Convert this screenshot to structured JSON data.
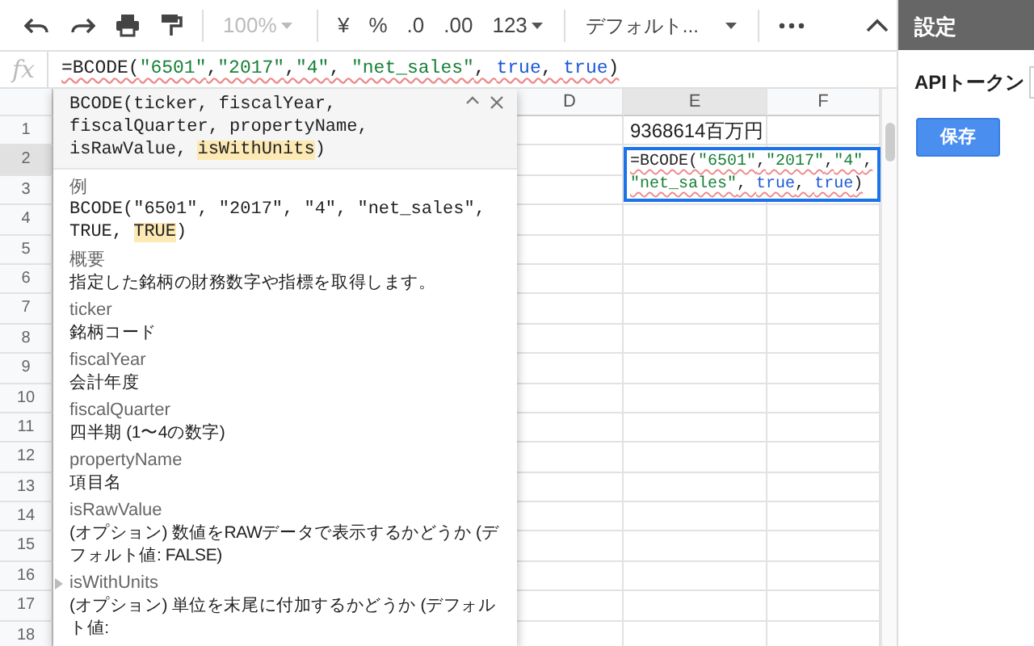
{
  "toolbar": {
    "zoom": "100%",
    "zoom_disabled": true,
    "currency": "¥",
    "percent": "%",
    "decrease_decimals": ".0",
    "increase_decimals": ".00",
    "number_format": "123",
    "font": "デフォルト..."
  },
  "formula_bar": {
    "label": "fx",
    "tokens": [
      {
        "kind": "plain",
        "text": "=BCODE("
      },
      {
        "kind": "string",
        "text": "\"6501\""
      },
      {
        "kind": "plain",
        "text": ","
      },
      {
        "kind": "string",
        "text": "\"2017\""
      },
      {
        "kind": "plain",
        "text": ","
      },
      {
        "kind": "string",
        "text": "\"4\""
      },
      {
        "kind": "plain",
        "text": ", "
      },
      {
        "kind": "string",
        "text": "\"net_sales\""
      },
      {
        "kind": "plain",
        "text": ", "
      },
      {
        "kind": "boolean",
        "text": "true"
      },
      {
        "kind": "plain",
        "text": ", "
      },
      {
        "kind": "boolean",
        "text": "true"
      },
      {
        "kind": "plain",
        "text": ")"
      }
    ]
  },
  "columns": [
    {
      "label": "D",
      "selected": false
    },
    {
      "label": "E",
      "selected": true
    },
    {
      "label": "F",
      "selected": false
    }
  ],
  "rows": [
    {
      "label": "1",
      "selected": false,
      "cells": [
        "",
        "9368614百万円",
        ""
      ]
    },
    {
      "label": "2",
      "selected": true
    },
    {
      "label": "3",
      "selected": false
    },
    {
      "label": "4",
      "selected": false
    },
    {
      "label": "5",
      "selected": false
    },
    {
      "label": "6",
      "selected": false
    },
    {
      "label": "7",
      "selected": false
    },
    {
      "label": "8",
      "selected": false
    },
    {
      "label": "9",
      "selected": false
    },
    {
      "label": "10",
      "selected": false
    },
    {
      "label": "11",
      "selected": false
    },
    {
      "label": "12",
      "selected": false
    },
    {
      "label": "13",
      "selected": false
    },
    {
      "label": "14",
      "selected": false
    },
    {
      "label": "15",
      "selected": false
    },
    {
      "label": "16",
      "selected": false
    },
    {
      "label": "17",
      "selected": false
    },
    {
      "label": "18",
      "selected": false
    }
  ],
  "cell_editor": {
    "tokens": [
      {
        "kind": "plain",
        "text": "=BCODE("
      },
      {
        "kind": "string",
        "text": "\"6501\""
      },
      {
        "kind": "plain",
        "text": ","
      },
      {
        "kind": "string",
        "text": "\"2017\""
      },
      {
        "kind": "plain",
        "text": ","
      },
      {
        "kind": "string",
        "text": "\"4\""
      },
      {
        "kind": "plain",
        "text": ", "
      },
      {
        "kind": "string",
        "text": "\"net_sales\""
      },
      {
        "kind": "plain",
        "text": ", "
      },
      {
        "kind": "boolean",
        "text": "true"
      },
      {
        "kind": "plain",
        "text": ", "
      },
      {
        "kind": "boolean",
        "text": "true"
      },
      {
        "kind": "plain",
        "text": ")"
      }
    ]
  },
  "help_popup": {
    "signature": [
      {
        "text": "BCODE(ticker, fiscalYear, fiscalQuarter, propertyName, isRawValue, ",
        "highlighted": false
      },
      {
        "text": "isWithUnits",
        "highlighted": true
      },
      {
        "text": ")",
        "highlighted": false
      }
    ],
    "sections": [
      {
        "label": "例",
        "kind": "code",
        "parts": [
          {
            "text": "BCODE(\"6501\", \"2017\", \"4\", \"net_sales\", TRUE, ",
            "highlighted": false
          },
          {
            "text": "TRUE",
            "highlighted": true
          },
          {
            "text": ")",
            "highlighted": false
          }
        ]
      },
      {
        "label": "概要",
        "text": "指定した銘柄の財務数字や指標を取得します。"
      },
      {
        "label": "ticker",
        "text": "銘柄コード"
      },
      {
        "label": "fiscalYear",
        "text": "会計年度"
      },
      {
        "label": "fiscalQuarter",
        "text": "四半期 (1〜4の数字)"
      },
      {
        "label": "propertyName",
        "text": "項目名"
      },
      {
        "label": "isRawValue",
        "text": "(オプション) 数値をRAWデータで表示するかどうか (デフォルト値: FALSE)"
      },
      {
        "label": "isWithUnits",
        "current": true,
        "text": "(オプション) 単位を末尾に付加するかどうか (デフォルト値:"
      }
    ]
  },
  "side_panel": {
    "title": "設定",
    "token_label": "APIトークン",
    "save_button": "保存"
  }
}
